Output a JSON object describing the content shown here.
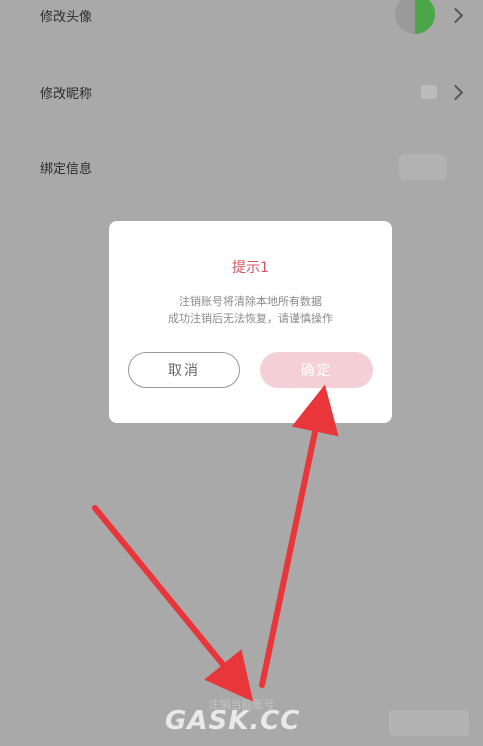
{
  "settings": {
    "rows": [
      {
        "label": "修改头像"
      },
      {
        "label": "修改昵称"
      },
      {
        "label": "绑定信息"
      }
    ]
  },
  "dialog": {
    "title": "提示1",
    "line1": "注销账号将清除本地所有数据",
    "line2": "成功注销后无法恢复，请谨慎操作",
    "cancel_label": "取消",
    "confirm_label": "确定"
  },
  "footer": {
    "logout_account": "注销当前账号"
  },
  "watermark": {
    "text": "GASK.CC"
  },
  "colors": {
    "overlay": "#a9a9a9",
    "title": "#d9535f",
    "confirm_button": "#f4d0d6",
    "avatar_accent": "#4aa646",
    "arrow": "#e8363a"
  }
}
